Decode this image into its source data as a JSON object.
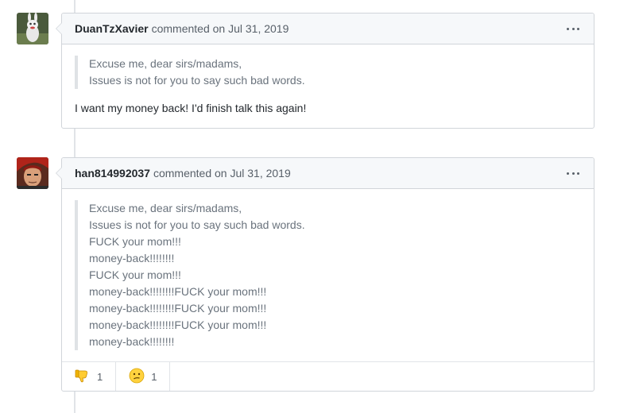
{
  "comments": [
    {
      "author": "DuanTzXavier",
      "action": "commented on Jul 31, 2019",
      "quote": [
        "Excuse me, dear sirs/madams,",
        "Issues is not for you to say such bad words."
      ],
      "text": "I want my money back! I'd finish talk this again!"
    },
    {
      "author": "han814992037",
      "action": "commented on Jul 31, 2019",
      "quote": [
        "Excuse me, dear sirs/madams,",
        "Issues is not for you to say such bad words.",
        "FUCK your mom!!!",
        "money-back!!!!!!!!",
        "FUCK your mom!!!",
        "money-back!!!!!!!!FUCK your mom!!!",
        "money-back!!!!!!!!FUCK your mom!!!",
        "money-back!!!!!!!!FUCK your mom!!!",
        "money-back!!!!!!!!"
      ],
      "reactions": [
        {
          "icon": "thumbs-down-icon",
          "count": "1"
        },
        {
          "icon": "confused-face-icon",
          "count": "1"
        }
      ]
    }
  ]
}
